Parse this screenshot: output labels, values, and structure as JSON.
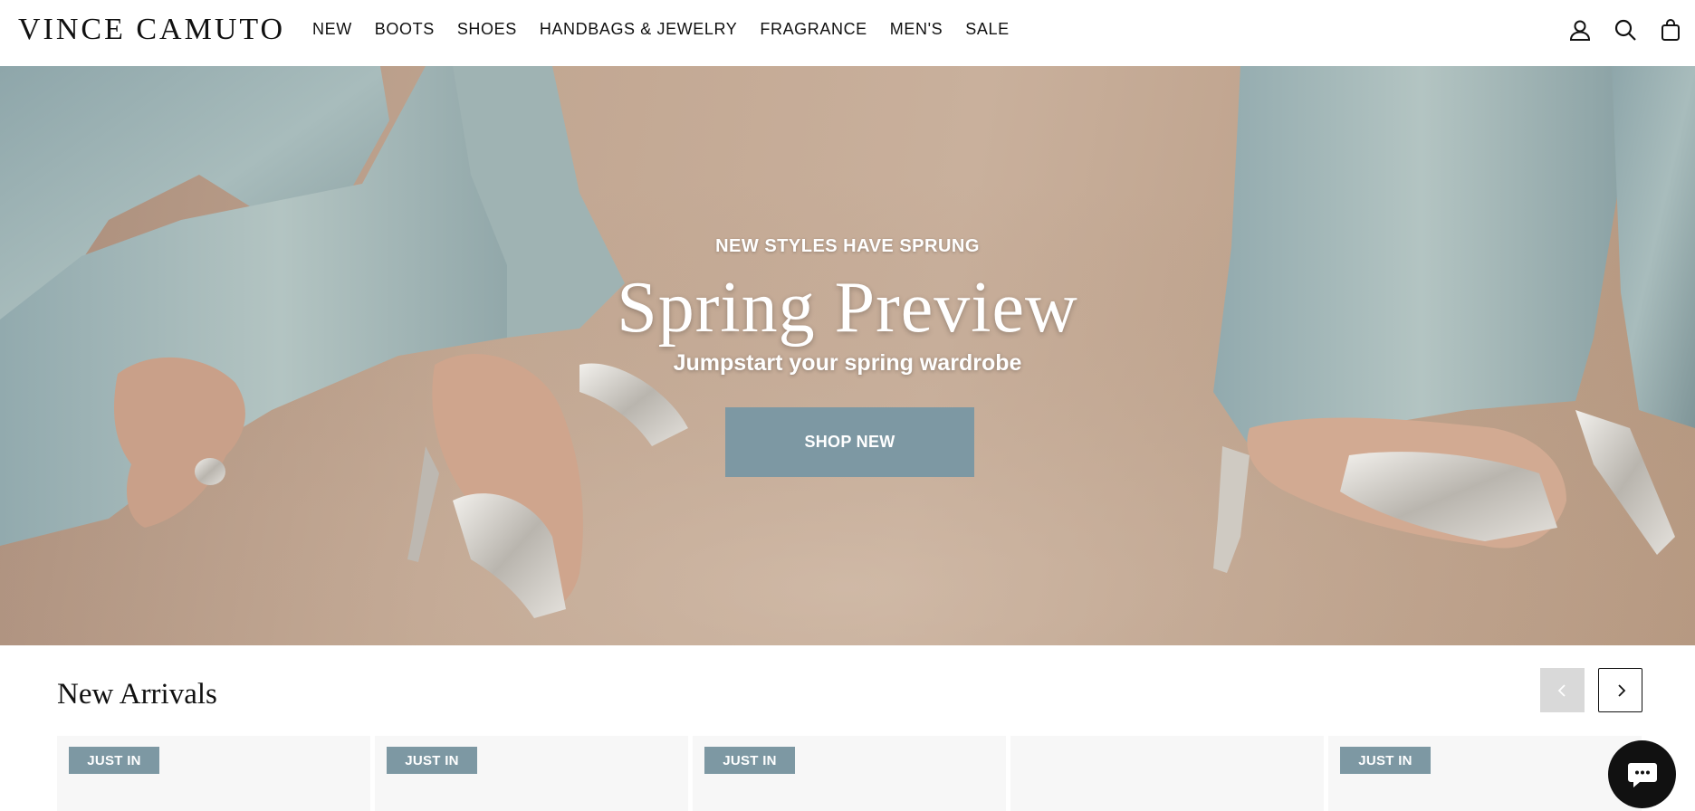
{
  "header": {
    "logo": "VINCE CAMUTO",
    "nav": [
      "NEW",
      "BOOTS",
      "SHOES",
      "HANDBAGS & JEWELRY",
      "FRAGRANCE",
      "MEN'S",
      "SALE"
    ],
    "icons": [
      "account-icon",
      "search-icon",
      "cart-icon"
    ]
  },
  "hero": {
    "eyebrow": "NEW STYLES HAVE SPRUNG",
    "title": "Spring Preview",
    "subtitle": "Jumpstart your spring wardrobe",
    "cta": "SHOP NEW"
  },
  "arrivals": {
    "title": "New Arrivals",
    "cards": [
      {
        "badge": "JUST IN"
      },
      {
        "badge": "JUST IN"
      },
      {
        "badge": "JUST IN"
      },
      {
        "badge": ""
      },
      {
        "badge": "JUST IN"
      }
    ]
  },
  "colors": {
    "accent": "#7d98a3",
    "text": "#111111",
    "hero_bg": "#c4aa95"
  }
}
